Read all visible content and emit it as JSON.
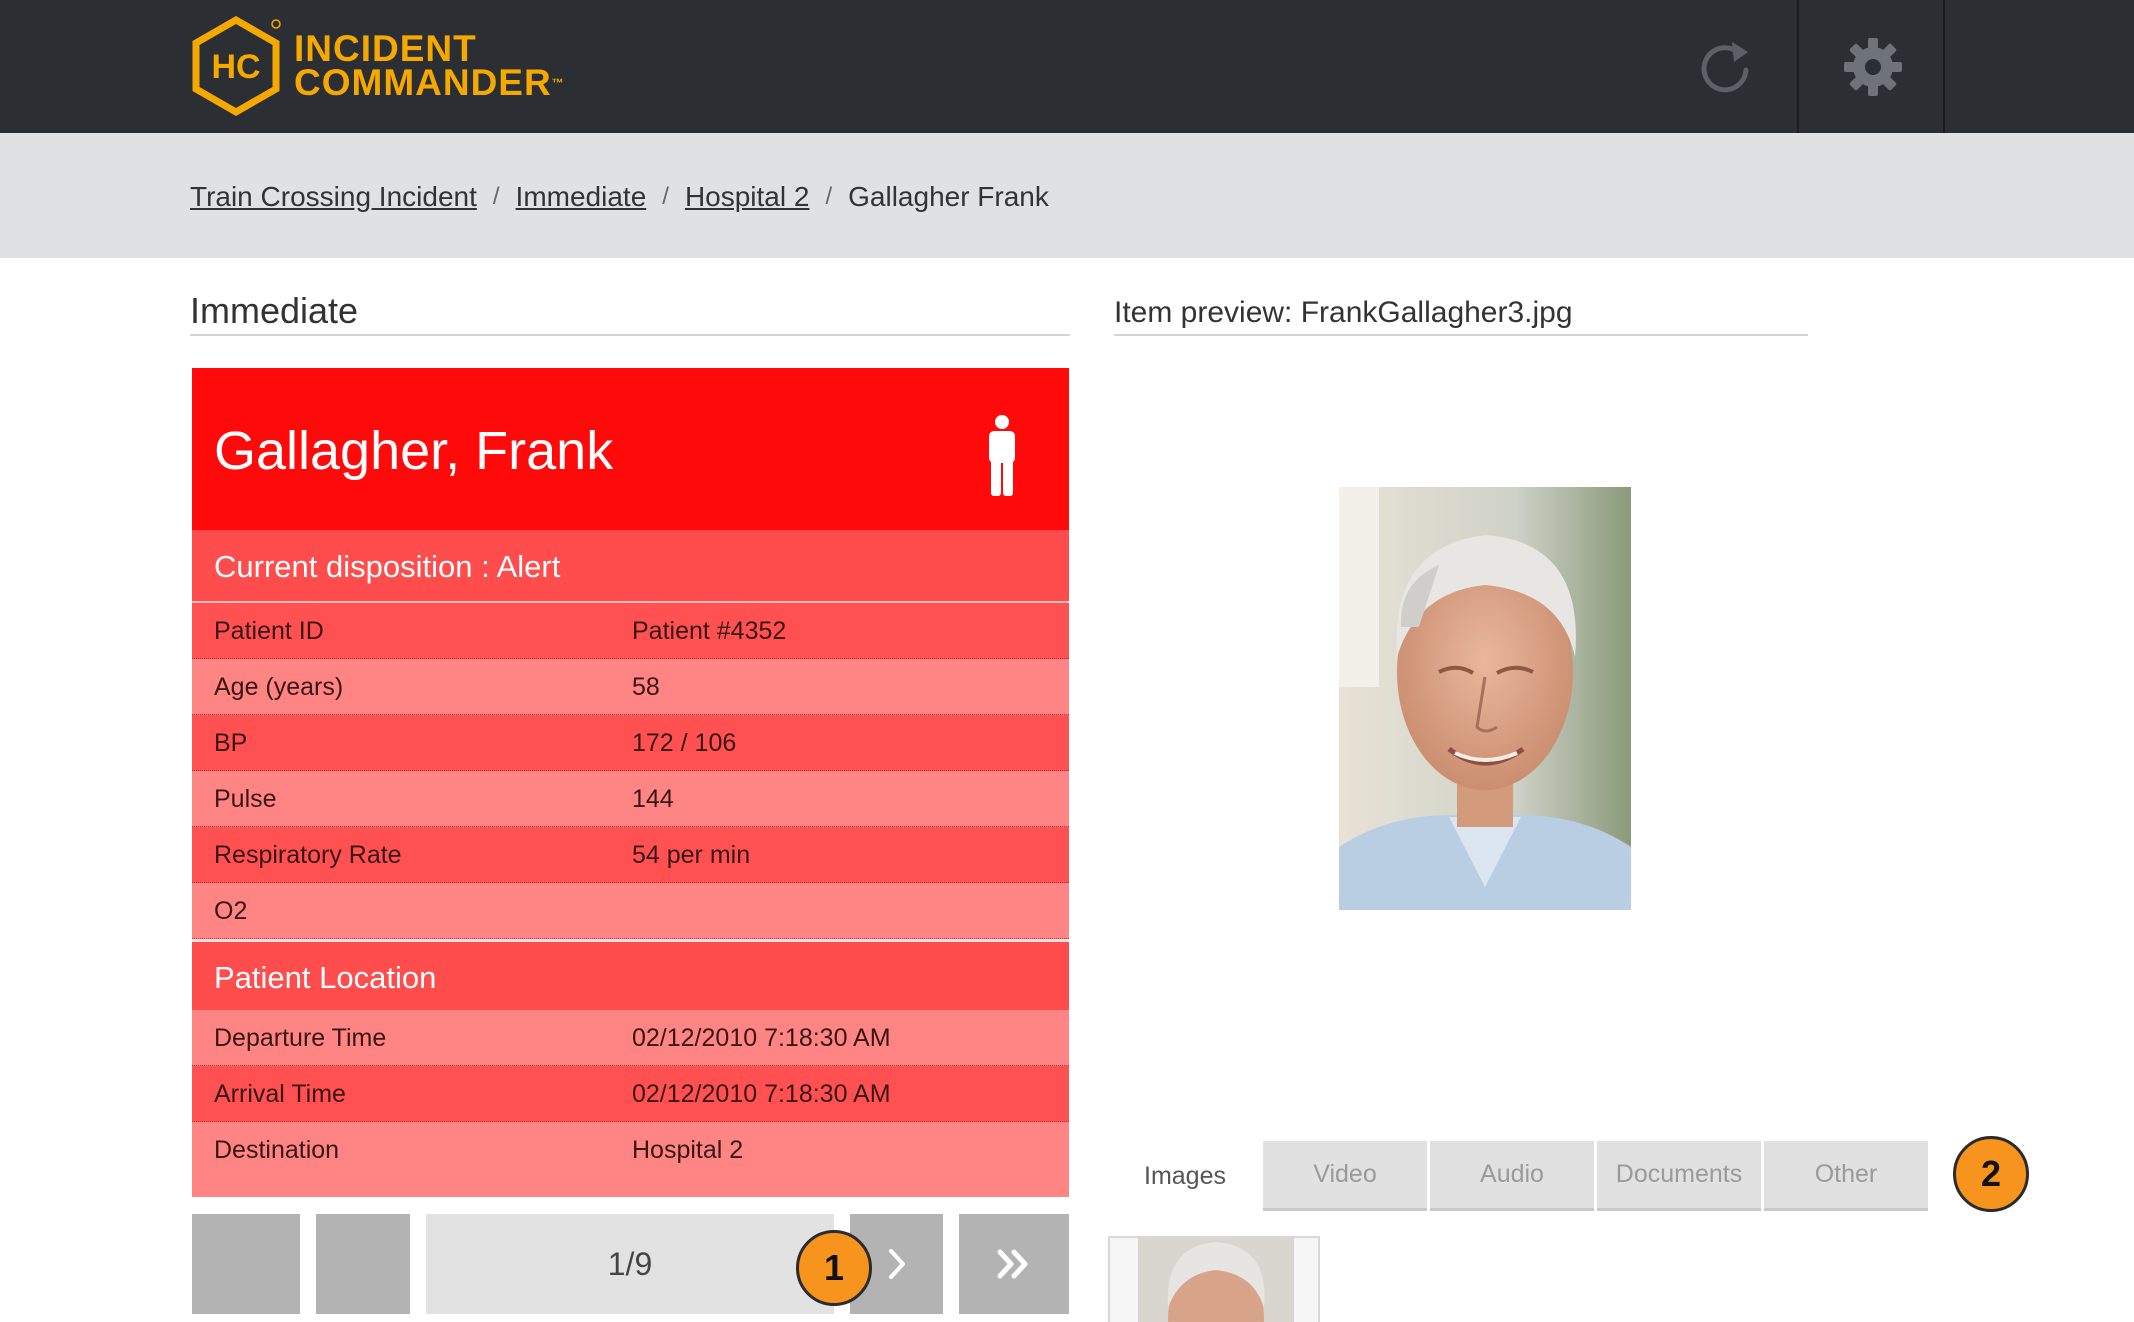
{
  "app": {
    "logo_initials": "HC",
    "logo_line1": "INCIDENT",
    "logo_line2": "COMMANDER",
    "trademark": "™",
    "accent_color": "#f5a800",
    "header_bg": "#2b2e33"
  },
  "header": {
    "refresh_icon": "refresh-icon",
    "settings_icon": "gear-icon"
  },
  "breadcrumb": {
    "items": [
      {
        "label": "Train Crossing Incident",
        "link": true
      },
      {
        "label": "Immediate",
        "link": true
      },
      {
        "label": "Hospital 2",
        "link": true
      },
      {
        "label": "Gallagher Frank",
        "link": false
      }
    ],
    "separator": "/"
  },
  "patient": {
    "section_title": "Immediate",
    "name": "Gallagher, Frank",
    "icon": "person-icon",
    "triage_color": "#ff0a0a",
    "disposition": "Current disposition : Alert",
    "vitals": [
      {
        "label": "Patient ID",
        "value": "Patient #4352"
      },
      {
        "label": "Age (years)",
        "value": "58"
      },
      {
        "label": "BP",
        "value": "172 / 106"
      },
      {
        "label": "Pulse",
        "value": "144"
      },
      {
        "label": "Respiratory Rate",
        "value": "54 per min"
      },
      {
        "label": "O2",
        "value": ""
      }
    ],
    "location_title": "Patient Location",
    "location": [
      {
        "label": "Departure Time",
        "value": "02/12/2010 7:18:30 AM"
      },
      {
        "label": "Arrival Time",
        "value": "02/12/2010 7:18:30 AM"
      },
      {
        "label": "Destination",
        "value": "Hospital 2"
      }
    ]
  },
  "pager": {
    "count": "1/9",
    "next_icon": "chevron-right-icon",
    "last_icon": "double-chevron-right-icon"
  },
  "preview": {
    "title": "Item preview: FrankGallagher3.jpg"
  },
  "media_tabs": [
    {
      "label": "Images",
      "active": true
    },
    {
      "label": "Video",
      "active": false
    },
    {
      "label": "Audio",
      "active": false
    },
    {
      "label": "Documents",
      "active": false
    },
    {
      "label": "Other",
      "active": false
    }
  ],
  "annotations": {
    "badge1": "1",
    "badge2": "2",
    "badge_color": "#f7941d"
  }
}
